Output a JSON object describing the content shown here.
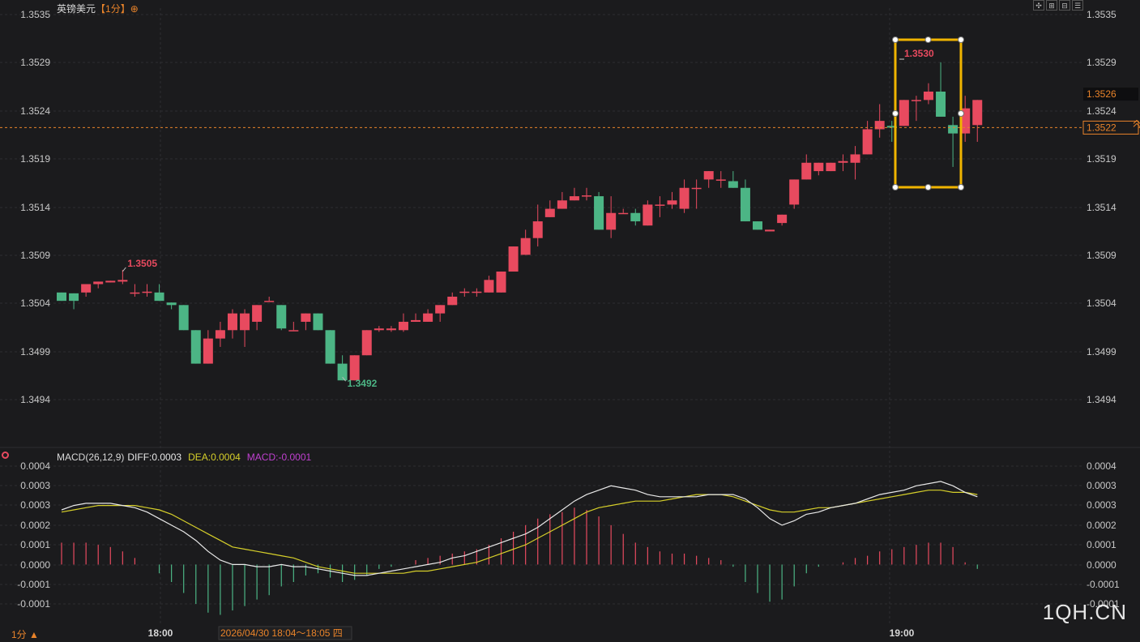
{
  "header": {
    "symbol": "英镑美元",
    "period": "【1分】",
    "settings_glyph": "⊕"
  },
  "toolbar": [
    "✣",
    "⊞",
    "⊟",
    "☰"
  ],
  "colors": {
    "up": "#e84a5f",
    "down": "#4cb585",
    "diff": "#e8e8e8",
    "dea": "#d6cf2a",
    "macd": "#c040d0",
    "accent": "#e8832a",
    "select": "#f0b400"
  },
  "price_axis": {
    "ticks": [
      "1.3535",
      "1.3529",
      "1.3524",
      "1.3519",
      "1.3514",
      "1.3509",
      "1.3504",
      "1.3499",
      "1.3494"
    ]
  },
  "price_labels": {
    "current": "1.3526",
    "dashed_line": "1.3522",
    "high": "1.3505",
    "low": "1.3492",
    "selection_high": "1.3530"
  },
  "macd_header": {
    "name": "MACD(26,12,9)",
    "diff": "DIFF:0.0003",
    "dea": "DEA:0.0004",
    "macd": "MACD:-0.0001"
  },
  "macd_axis": {
    "ticks": [
      "0.0004",
      "0.0003",
      "0.0003",
      "0.0002",
      "0.0001",
      "0.0000",
      "-0.0001",
      "-0.0001"
    ]
  },
  "time_axis": {
    "labels": [
      "18:00",
      "19:00"
    ],
    "crosshair": "2026/04/30 18:04～18:05 四"
  },
  "footer": {
    "period_selector": "1分 ▲",
    "watermark": "1QH.CN"
  },
  "chart_data": {
    "type": "candlestick",
    "symbol": "英镑美元",
    "interval": "1分",
    "y_range": [
      1.34895,
      1.35355
    ],
    "high_mark": 1.3505,
    "low_mark": 1.3492,
    "current_price": 1.3526,
    "reference_price": 1.3522,
    "candles": [
      {
        "o": 1.35023,
        "c": 1.35013,
        "h": 1.35023,
        "l": 1.35013
      },
      {
        "o": 1.35022,
        "c": 1.35013,
        "h": 1.35022,
        "l": 1.35003
      },
      {
        "o": 1.35023,
        "c": 1.35033,
        "h": 1.35033,
        "l": 1.35018
      },
      {
        "o": 1.35033,
        "c": 1.35036,
        "h": 1.35036,
        "l": 1.35028
      },
      {
        "o": 1.35035,
        "c": 1.35037,
        "h": 1.35037,
        "l": 1.35035
      },
      {
        "o": 1.35036,
        "c": 1.35038,
        "h": 1.3505,
        "l": 1.35033
      },
      {
        "o": 1.35023,
        "c": 1.35023,
        "h": 1.35033,
        "l": 1.35018
      },
      {
        "o": 1.35023,
        "c": 1.35024,
        "h": 1.35033,
        "l": 1.35018
      },
      {
        "o": 1.35023,
        "c": 1.35013,
        "h": 1.35033,
        "l": 1.35013
      },
      {
        "o": 1.35011,
        "c": 1.35008,
        "h": 1.35011,
        "l": 1.35003
      },
      {
        "o": 1.35008,
        "c": 1.34978,
        "h": 1.35008,
        "l": 1.34978
      },
      {
        "o": 1.34978,
        "c": 1.34938,
        "h": 1.34978,
        "l": 1.34938
      },
      {
        "o": 1.34938,
        "c": 1.34968,
        "h": 1.34978,
        "l": 1.34938
      },
      {
        "o": 1.34968,
        "c": 1.34978,
        "h": 1.34988,
        "l": 1.34958
      },
      {
        "o": 1.34978,
        "c": 1.34998,
        "h": 1.35003,
        "l": 1.34968
      },
      {
        "o": 1.34978,
        "c": 1.34998,
        "h": 1.35003,
        "l": 1.34958
      },
      {
        "o": 1.34988,
        "c": 1.35008,
        "h": 1.35008,
        "l": 1.34978
      },
      {
        "o": 1.35013,
        "c": 1.35013,
        "h": 1.35018,
        "l": 1.35013
      },
      {
        "o": 1.35008,
        "c": 1.3498,
        "h": 1.35008,
        "l": 1.34978
      },
      {
        "o": 1.34978,
        "c": 1.34978,
        "h": 1.34988,
        "l": 1.34978
      },
      {
        "o": 1.34988,
        "c": 1.34998,
        "h": 1.34998,
        "l": 1.34978
      },
      {
        "o": 1.34998,
        "c": 1.34978,
        "h": 1.34998,
        "l": 1.34978
      },
      {
        "o": 1.34978,
        "c": 1.34938,
        "h": 1.34978,
        "l": 1.34938
      },
      {
        "o": 1.34938,
        "c": 1.34918,
        "h": 1.34948,
        "l": 1.34918
      },
      {
        "o": 1.34918,
        "c": 1.34948,
        "h": 1.34948,
        "l": 1.34918
      },
      {
        "o": 1.34948,
        "c": 1.34978,
        "h": 1.34978,
        "l": 1.34948
      },
      {
        "o": 1.34978,
        "c": 1.3498,
        "h": 1.34983,
        "l": 1.34976
      },
      {
        "o": 1.34978,
        "c": 1.3498,
        "h": 1.34983,
        "l": 1.34976
      },
      {
        "o": 1.34978,
        "c": 1.34988,
        "h": 1.34998,
        "l": 1.34976
      },
      {
        "o": 1.34988,
        "c": 1.3499,
        "h": 1.34998,
        "l": 1.34988
      },
      {
        "o": 1.34988,
        "c": 1.34998,
        "h": 1.35003,
        "l": 1.34988
      },
      {
        "o": 1.34998,
        "c": 1.35008,
        "h": 1.35008,
        "l": 1.34988
      },
      {
        "o": 1.35008,
        "c": 1.35018,
        "h": 1.35023,
        "l": 1.35008
      },
      {
        "o": 1.35023,
        "c": 1.35024,
        "h": 1.35028,
        "l": 1.35018
      },
      {
        "o": 1.35023,
        "c": 1.35024,
        "h": 1.35028,
        "l": 1.35018
      },
      {
        "o": 1.35023,
        "c": 1.35038,
        "h": 1.35043,
        "l": 1.35023
      },
      {
        "o": 1.35023,
        "c": 1.35048,
        "h": 1.35048,
        "l": 1.35023
      },
      {
        "o": 1.35048,
        "c": 1.35078,
        "h": 1.35078,
        "l": 1.35048
      },
      {
        "o": 1.35068,
        "c": 1.35088,
        "h": 1.35098,
        "l": 1.35068
      },
      {
        "o": 1.35088,
        "c": 1.35108,
        "h": 1.35128,
        "l": 1.35078
      },
      {
        "o": 1.35113,
        "c": 1.35123,
        "h": 1.35133,
        "l": 1.35113
      },
      {
        "o": 1.35123,
        "c": 1.35133,
        "h": 1.35143,
        "l": 1.35123
      },
      {
        "o": 1.35133,
        "c": 1.35138,
        "h": 1.35148,
        "l": 1.35133
      },
      {
        "o": 1.35138,
        "c": 1.35139,
        "h": 1.35148,
        "l": 1.35133
      },
      {
        "o": 1.35138,
        "c": 1.35098,
        "h": 1.35143,
        "l": 1.35098
      },
      {
        "o": 1.35098,
        "c": 1.35118,
        "h": 1.35138,
        "l": 1.35088
      },
      {
        "o": 1.35118,
        "c": 1.35118,
        "h": 1.35123,
        "l": 1.35118
      },
      {
        "o": 1.35118,
        "c": 1.35108,
        "h": 1.35123,
        "l": 1.35103
      },
      {
        "o": 1.35103,
        "c": 1.35128,
        "h": 1.35133,
        "l": 1.35103
      },
      {
        "o": 1.35128,
        "c": 1.35128,
        "h": 1.35138,
        "l": 1.35113
      },
      {
        "o": 1.35128,
        "c": 1.35133,
        "h": 1.35143,
        "l": 1.35123
      },
      {
        "o": 1.35123,
        "c": 1.35148,
        "h": 1.35158,
        "l": 1.35118
      },
      {
        "o": 1.35148,
        "c": 1.35148,
        "h": 1.35158,
        "l": 1.35123
      },
      {
        "o": 1.35158,
        "c": 1.35168,
        "h": 1.35168,
        "l": 1.35148
      },
      {
        "o": 1.35158,
        "c": 1.35158,
        "h": 1.35168,
        "l": 1.35148
      },
      {
        "o": 1.35156,
        "c": 1.35148,
        "h": 1.35168,
        "l": 1.35148
      },
      {
        "o": 1.35148,
        "c": 1.35108,
        "h": 1.35158,
        "l": 1.35108
      },
      {
        "o": 1.35108,
        "c": 1.35098,
        "h": 1.35108,
        "l": 1.35098
      },
      {
        "o": 1.35096,
        "c": 1.35098,
        "h": 1.35098,
        "l": 1.35096
      },
      {
        "o": 1.35106,
        "c": 1.35116,
        "h": 1.35116,
        "l": 1.35103
      },
      {
        "o": 1.35128,
        "c": 1.35158,
        "h": 1.35158,
        "l": 1.35123
      },
      {
        "o": 1.35158,
        "c": 1.35178,
        "h": 1.35188,
        "l": 1.35158
      },
      {
        "o": 1.35168,
        "c": 1.35178,
        "h": 1.35178,
        "l": 1.35163
      },
      {
        "o": 1.35168,
        "c": 1.35178,
        "h": 1.35178,
        "l": 1.35168
      },
      {
        "o": 1.35178,
        "c": 1.3518,
        "h": 1.35188,
        "l": 1.35168
      },
      {
        "o": 1.35178,
        "c": 1.35188,
        "h": 1.35198,
        "l": 1.35158
      },
      {
        "o": 1.35188,
        "c": 1.35218,
        "h": 1.35228,
        "l": 1.35188
      },
      {
        "o": 1.35218,
        "c": 1.35228,
        "h": 1.35248,
        "l": 1.35208
      },
      {
        "o": 1.35222,
        "c": 1.3522,
        "h": 1.35228,
        "l": 1.35203
      },
      {
        "o": 1.35222,
        "c": 1.35253,
        "h": 1.35253,
        "l": 1.35222
      },
      {
        "o": 1.35253,
        "c": 1.35253,
        "h": 1.35258,
        "l": 1.35228
      },
      {
        "o": 1.35253,
        "c": 1.35263,
        "h": 1.35273,
        "l": 1.35248
      },
      {
        "o": 1.35263,
        "c": 1.35233,
        "h": 1.35298,
        "l": 1.35233
      },
      {
        "o": 1.35223,
        "c": 1.35213,
        "h": 1.35233,
        "l": 1.35173
      },
      {
        "o": 1.35213,
        "c": 1.35243,
        "h": 1.35258,
        "l": 1.35203
      },
      {
        "o": 1.35223,
        "c": 1.35253,
        "h": 1.35253,
        "l": 1.35203
      }
    ],
    "macd": {
      "diff": [
        0.00025,
        0.00027,
        0.00028,
        0.00028,
        0.00028,
        0.00027,
        0.00026,
        0.00024,
        0.00021,
        0.00018,
        0.00015,
        0.00011,
        6e-05,
        2e-05,
        0.0,
        0.0,
        -1e-05,
        -1e-05,
        0.0,
        -1e-05,
        -1e-05,
        -2e-05,
        -3e-05,
        -4e-05,
        -5e-05,
        -5e-05,
        -4e-05,
        -3e-05,
        -2e-05,
        -1e-05,
        0.0,
        1e-05,
        3e-05,
        4e-05,
        6e-05,
        8e-05,
        0.0001,
        0.00012,
        0.00014,
        0.00017,
        0.00021,
        0.00025,
        0.00029,
        0.00032,
        0.00034,
        0.00036,
        0.00035,
        0.00034,
        0.00032,
        0.00031,
        0.00031,
        0.00031,
        0.00031,
        0.00032,
        0.00032,
        0.00032,
        0.0003,
        0.00026,
        0.00021,
        0.00018,
        0.0002,
        0.00023,
        0.00024,
        0.00026,
        0.00027,
        0.00028,
        0.0003,
        0.00032,
        0.00033,
        0.00034,
        0.00036,
        0.00037,
        0.00038,
        0.00036,
        0.00033,
        0.00031
      ],
      "dea": [
        0.00024,
        0.00025,
        0.00026,
        0.00027,
        0.00027,
        0.00027,
        0.00027,
        0.00026,
        0.00025,
        0.00023,
        0.0002,
        0.00017,
        0.00014,
        0.00011,
        8e-05,
        7e-05,
        6e-05,
        5e-05,
        4e-05,
        3e-05,
        1e-05,
        -1e-05,
        -2e-05,
        -3e-05,
        -4e-05,
        -4e-05,
        -4e-05,
        -4e-05,
        -4e-05,
        -3e-05,
        -3e-05,
        -2e-05,
        -1e-05,
        0.0,
        1e-05,
        3e-05,
        5e-05,
        7e-05,
        9e-05,
        0.00012,
        0.00015,
        0.00018,
        0.00021,
        0.00024,
        0.00026,
        0.00027,
        0.00028,
        0.00029,
        0.00029,
        0.00029,
        0.0003,
        0.00031,
        0.00032,
        0.00032,
        0.00032,
        0.00031,
        0.00029,
        0.00027,
        0.00025,
        0.00024,
        0.00024,
        0.00025,
        0.00026,
        0.00026,
        0.00027,
        0.00028,
        0.00029,
        0.0003,
        0.00031,
        0.00032,
        0.00033,
        0.00034,
        0.00034,
        0.00033,
        0.00033,
        0.00032
      ],
      "hist": [
        0.0001,
        0.0001,
        0.0001,
        9e-05,
        8e-05,
        6e-05,
        3e-05,
        0.0,
        -4e-05,
        -8e-05,
        -0.00013,
        -0.00018,
        -0.00022,
        -0.00023,
        -0.00021,
        -0.00019,
        -0.00016,
        -0.00014,
        -0.0001,
        -8e-05,
        -5e-05,
        -4e-05,
        -6e-05,
        -8e-05,
        -7e-05,
        -5e-05,
        -2e-05,
        -1e-05,
        0.0,
        2e-05,
        3e-05,
        4e-05,
        5e-05,
        6e-05,
        7e-05,
        9e-05,
        0.00012,
        0.00015,
        0.00018,
        0.00021,
        0.00023,
        0.00024,
        0.00026,
        0.00025,
        0.00022,
        0.00018,
        0.00014,
        0.0001,
        8e-05,
        6e-05,
        5e-05,
        5e-05,
        4e-05,
        3e-05,
        2e-05,
        -1e-05,
        -8e-05,
        -0.00013,
        -0.00017,
        -0.00016,
        -0.0001,
        -4e-05,
        -1e-05,
        0.0,
        1e-05,
        3e-05,
        4e-05,
        6e-05,
        7e-05,
        8e-05,
        9e-05,
        0.0001,
        0.0001,
        8e-05,
        1e-05,
        -2e-05
      ]
    }
  }
}
